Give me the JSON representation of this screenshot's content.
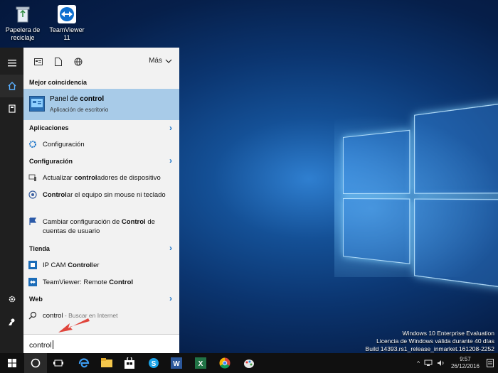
{
  "desktop": {
    "icons": [
      {
        "label_line1": "Papelera de",
        "label_line2": "reciclaje",
        "icon": "recycle-bin-icon"
      },
      {
        "label_line1": "TeamViewer 11",
        "label_line2": "",
        "icon": "teamviewer-icon"
      }
    ],
    "watermark": {
      "line1": "Windows 10 Enterprise Evaluation",
      "line2": "Licencia de Windows válida durante 40 días",
      "line3": "Build 14393.rs1_release_inmarket.161208-2252"
    }
  },
  "rail": {
    "items": [
      "hamburger-icon",
      "home-icon",
      "notebook-icon",
      "settings-icon",
      "feedback-icon"
    ]
  },
  "search_panel": {
    "filter_more": "Más",
    "best_match_header": "Mejor coincidencia",
    "best_match": {
      "title_prefix": "Panel de ",
      "title_bold": "control",
      "subtitle": "Aplicación de escritorio"
    },
    "sections": [
      {
        "header": "Aplicaciones",
        "items": [
          {
            "pre": "Configuración",
            "bold": "",
            "post": ""
          }
        ]
      },
      {
        "header": "Configuración",
        "items": [
          {
            "pre": "Actualizar ",
            "bold": "control",
            "post": "adores de dispositivo"
          },
          {
            "pre": "",
            "bold": "Control",
            "post": "ar el equipo sin mouse ni teclado"
          },
          {
            "pre": "Cambiar configuración de ",
            "bold": "Control",
            "post": " de cuentas de usuario"
          }
        ]
      },
      {
        "header": "Tienda",
        "items": [
          {
            "pre": "IP CAM ",
            "bold": "Control",
            "post": "ler"
          },
          {
            "pre": "TeamViewer: Remote ",
            "bold": "Control",
            "post": ""
          }
        ]
      },
      {
        "header": "Web",
        "items": [
          {
            "pre": "control",
            "bold": "",
            "post": " - Buscar en Internet"
          }
        ]
      }
    ],
    "query": "control"
  },
  "taskbar": {
    "apps": [
      "start-icon",
      "cortana-icon",
      "task-view-icon",
      "edge-icon",
      "explorer-icon",
      "store-icon",
      "skype-icon",
      "word-icon",
      "excel-icon",
      "chrome-icon",
      "paint-icon"
    ],
    "time": "9:57",
    "date": "26/12/2016"
  },
  "colors": {
    "accent": "#1a73c8",
    "highlight": "#a8cbe8",
    "panel": "#f2f2f2",
    "taskbar": "#101010"
  }
}
